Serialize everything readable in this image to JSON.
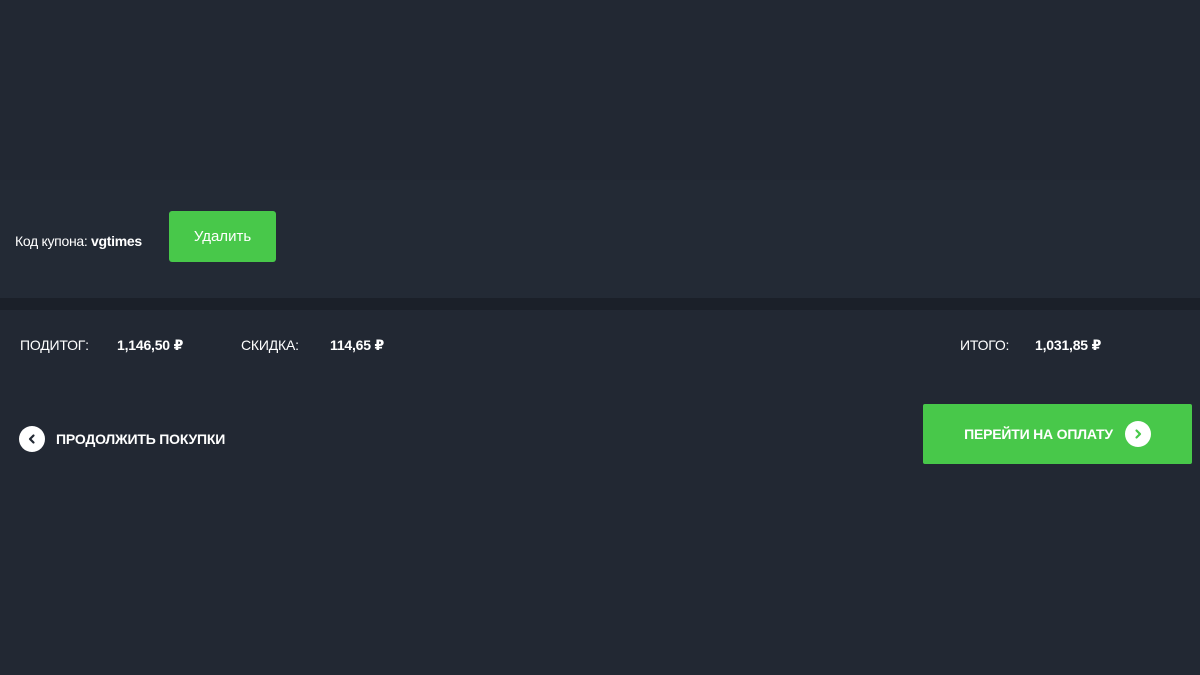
{
  "coupon": {
    "label": "Код купона:",
    "code": "vgtimes",
    "remove_label": "Удалить"
  },
  "totals": {
    "subtotal_label": "ПОДИТОГ:",
    "subtotal_value": "1,146,50 ₽",
    "discount_label": "СКИДКА:",
    "discount_value": "114,65 ₽",
    "total_label": "ИТОГО:",
    "total_value": "1,031,85 ₽"
  },
  "actions": {
    "continue_label": "ПРОДОЛЖИТЬ ПОКУПКИ",
    "continue_icon": "chevron-left-icon",
    "checkout_label": "ПЕРЕЙТИ НА ОПЛАТУ",
    "checkout_icon": "chevron-right-icon"
  },
  "colors": {
    "background": "#222833",
    "divider": "#1b2029",
    "accent_green": "#48c84a",
    "text": "#ffffff"
  }
}
